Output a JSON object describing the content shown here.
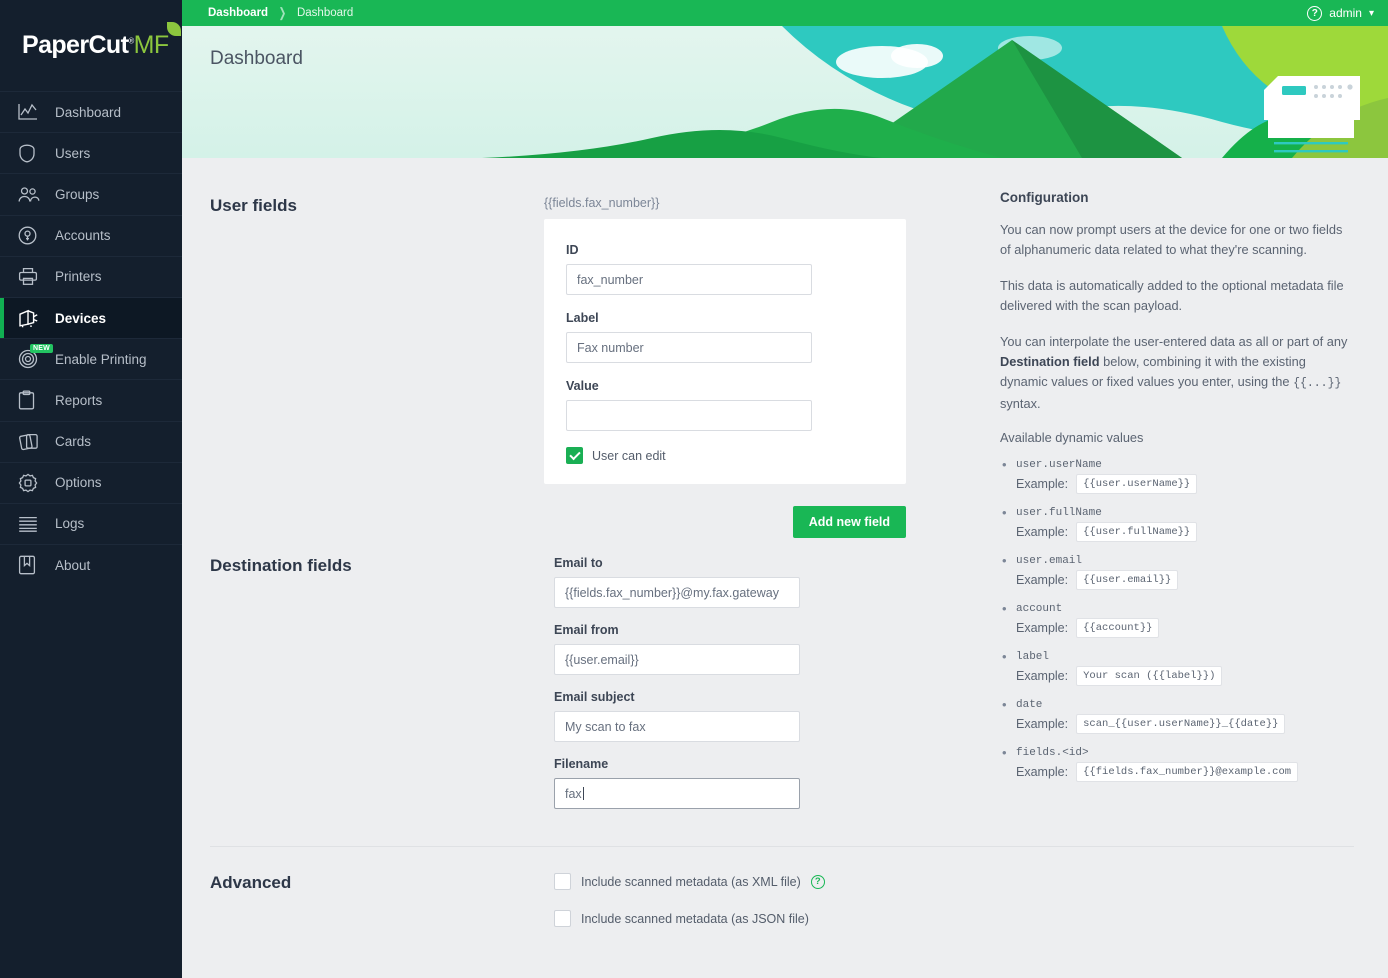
{
  "brand": {
    "name_a": "PaperCut",
    "name_b": "MF",
    "registered": "®"
  },
  "topbar": {
    "crumb_first": "Dashboard",
    "crumb_second": "Dashboard",
    "help_glyph": "?",
    "admin_label": "admin",
    "caret_glyph": "⌄"
  },
  "banner": {
    "title": "Dashboard"
  },
  "sidebar": {
    "items": [
      {
        "label": "Dashboard",
        "icon": "chart-line-icon",
        "active": false,
        "badge": ""
      },
      {
        "label": "Users",
        "icon": "user-icon",
        "active": false,
        "badge": ""
      },
      {
        "label": "Groups",
        "icon": "groups-icon",
        "active": false,
        "badge": ""
      },
      {
        "label": "Accounts",
        "icon": "account-coin-icon",
        "active": false,
        "badge": ""
      },
      {
        "label": "Printers",
        "icon": "printer-icon",
        "active": false,
        "badge": ""
      },
      {
        "label": "Devices",
        "icon": "device-icon",
        "active": true,
        "badge": ""
      },
      {
        "label": "Enable Printing",
        "icon": "target-icon",
        "active": false,
        "badge": "NEW"
      },
      {
        "label": "Reports",
        "icon": "clipboard-icon",
        "active": false,
        "badge": ""
      },
      {
        "label": "Cards",
        "icon": "cards-icon",
        "active": false,
        "badge": ""
      },
      {
        "label": "Options",
        "icon": "gear-icon",
        "active": false,
        "badge": ""
      },
      {
        "label": "Logs",
        "icon": "lines-icon",
        "active": false,
        "badge": ""
      },
      {
        "label": "About",
        "icon": "bookmark-icon",
        "active": false,
        "badge": ""
      }
    ]
  },
  "user_fields": {
    "section_title": "User fields",
    "token": "{{fields.fax_number}}",
    "id_label": "ID",
    "id_value": "fax_number",
    "label_label": "Label",
    "label_value": "Fax number",
    "value_label": "Value",
    "value_value": "",
    "user_can_edit_label": "User can edit",
    "user_can_edit_checked": true,
    "add_new_field_label": "Add new field"
  },
  "destination_fields": {
    "section_title": "Destination fields",
    "email_to_label": "Email to",
    "email_to_value": "{{fields.fax_number}}@my.fax.gateway",
    "email_from_label": "Email from",
    "email_from_value": "{{user.email}}",
    "email_subject_label": "Email subject",
    "email_subject_value": "My scan to fax",
    "filename_label": "Filename",
    "filename_value": "fax"
  },
  "advanced": {
    "section_title": "Advanced",
    "xml_label": "Include scanned metadata (as XML file)",
    "xml_checked": false,
    "xml_help_glyph": "?",
    "json_label": "Include scanned metadata (as JSON file)",
    "json_checked": false
  },
  "configuration": {
    "heading": "Configuration",
    "para1": "You can now prompt users at the device for one or two fields of alphanumeric data related to what they're scanning.",
    "para2": "This data is automatically added to the optional metadata file delivered with the scan payload.",
    "para3_a": "You can interpolate the user-entered data as all or part of any ",
    "para3_bold": "Destination field",
    "para3_b": " below, combining it with the existing dynamic values or fixed values you enter, using the ",
    "para3_code": "{{...}}",
    "para3_c": " syntax.",
    "available_title": "Available dynamic values",
    "example_label": "Example:",
    "dynamic_values": [
      {
        "name": "user.userName",
        "example": "{{user.userName}}"
      },
      {
        "name": "user.fullName",
        "example": "{{user.fullName}}"
      },
      {
        "name": "user.email",
        "example": "{{user.email}}"
      },
      {
        "name": "account",
        "example": "{{account}}"
      },
      {
        "name": "label",
        "example": "Your scan ({{label}})"
      },
      {
        "name": "date",
        "example": "scan_{{user.userName}}_{{date}}"
      },
      {
        "name": "fields.<id>",
        "example": "{{fields.fax_number}}@example.com"
      }
    ]
  },
  "colors": {
    "brand_green": "#19b755",
    "accent_leaf": "#8cc63e",
    "sidebar_bg": "#141f2d",
    "content_bg": "#edeef0",
    "active_marker": "#11b052"
  }
}
